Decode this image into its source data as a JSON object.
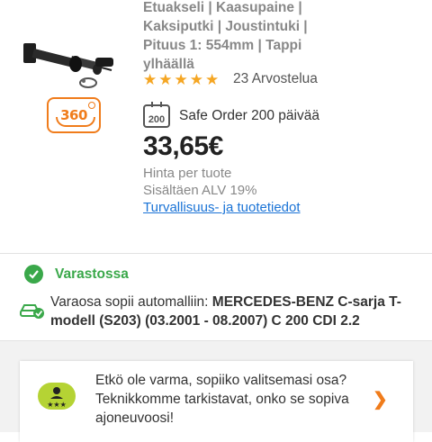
{
  "product": {
    "specs": "Etuakseli | Kaasupaine |\nKaksiputki | Joustintuki |\nPituus 1: 554mm | Tappi\nylhäällä",
    "rating_stars": 5,
    "reviews": "23 Arvostelua",
    "spin_label": "360",
    "safe_order_icon": "200",
    "safe_order": "Safe Order 200 päivää",
    "price": "33,65€",
    "price_note": "Hinta per tuote",
    "vat_note": "Sisältäen ALV 19%",
    "safety_link": "Turvallisuus- ja tuotetiedot"
  },
  "availability": {
    "stock": "Varastossa",
    "fit_prefix": "Varaosa sopii automalliin: ",
    "fit_vehicle": "MERCEDES-BENZ C-sarja T-modell (S203) (03.2001 - 08.2007) C 200 CDI 2.2"
  },
  "help": {
    "text": "Etkö ole varma, sopiiko valitsemasi osa? Teknikkomme tarkistavat, onko se sopiva ajoneuvoosi!"
  },
  "colors": {
    "accent": "#f07c1b",
    "stock_green": "#3aa84a",
    "link_blue": "#1a73d6",
    "star": "#f5a623",
    "help_icon": "#b5d334"
  },
  "icons": [
    "360-view-icon",
    "star-icon",
    "calendar-200-icon",
    "check-icon",
    "car-check-icon",
    "technician-icon",
    "chevron-right-icon"
  ]
}
